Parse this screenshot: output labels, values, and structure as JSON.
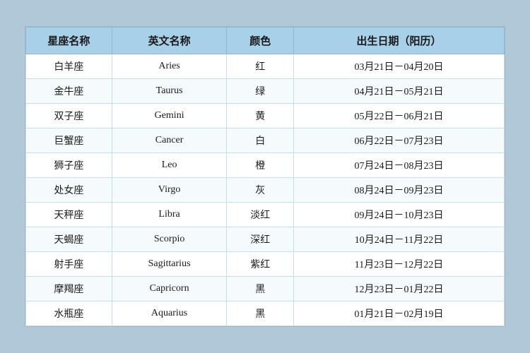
{
  "table": {
    "headers": [
      "星座名称",
      "英文名称",
      "颜色",
      "出生日期（阳历）"
    ],
    "rows": [
      {
        "name": "白羊座",
        "en": "Aries",
        "color": "红",
        "date": "03月21日－04月20日"
      },
      {
        "name": "金牛座",
        "en": "Taurus",
        "color": "绿",
        "date": "04月21日－05月21日"
      },
      {
        "name": "双子座",
        "en": "Gemini",
        "color": "黄",
        "date": "05月22日－06月21日"
      },
      {
        "name": "巨蟹座",
        "en": "Cancer",
        "color": "白",
        "date": "06月22日－07月23日"
      },
      {
        "name": "狮子座",
        "en": "Leo",
        "color": "橙",
        "date": "07月24日－08月23日"
      },
      {
        "name": "处女座",
        "en": "Virgo",
        "color": "灰",
        "date": "08月24日－09月23日"
      },
      {
        "name": "天秤座",
        "en": "Libra",
        "color": "淡红",
        "date": "09月24日－10月23日"
      },
      {
        "name": "天蝎座",
        "en": "Scorpio",
        "color": "深红",
        "date": "10月24日－11月22日"
      },
      {
        "name": "射手座",
        "en": "Sagittarius",
        "color": "紫红",
        "date": "11月23日－12月22日"
      },
      {
        "name": "摩羯座",
        "en": "Capricorn",
        "color": "黑",
        "date": "12月23日－01月22日"
      },
      {
        "name": "水瓶座",
        "en": "Aquarius",
        "color": "黑",
        "date": "01月21日－02月19日"
      }
    ]
  }
}
